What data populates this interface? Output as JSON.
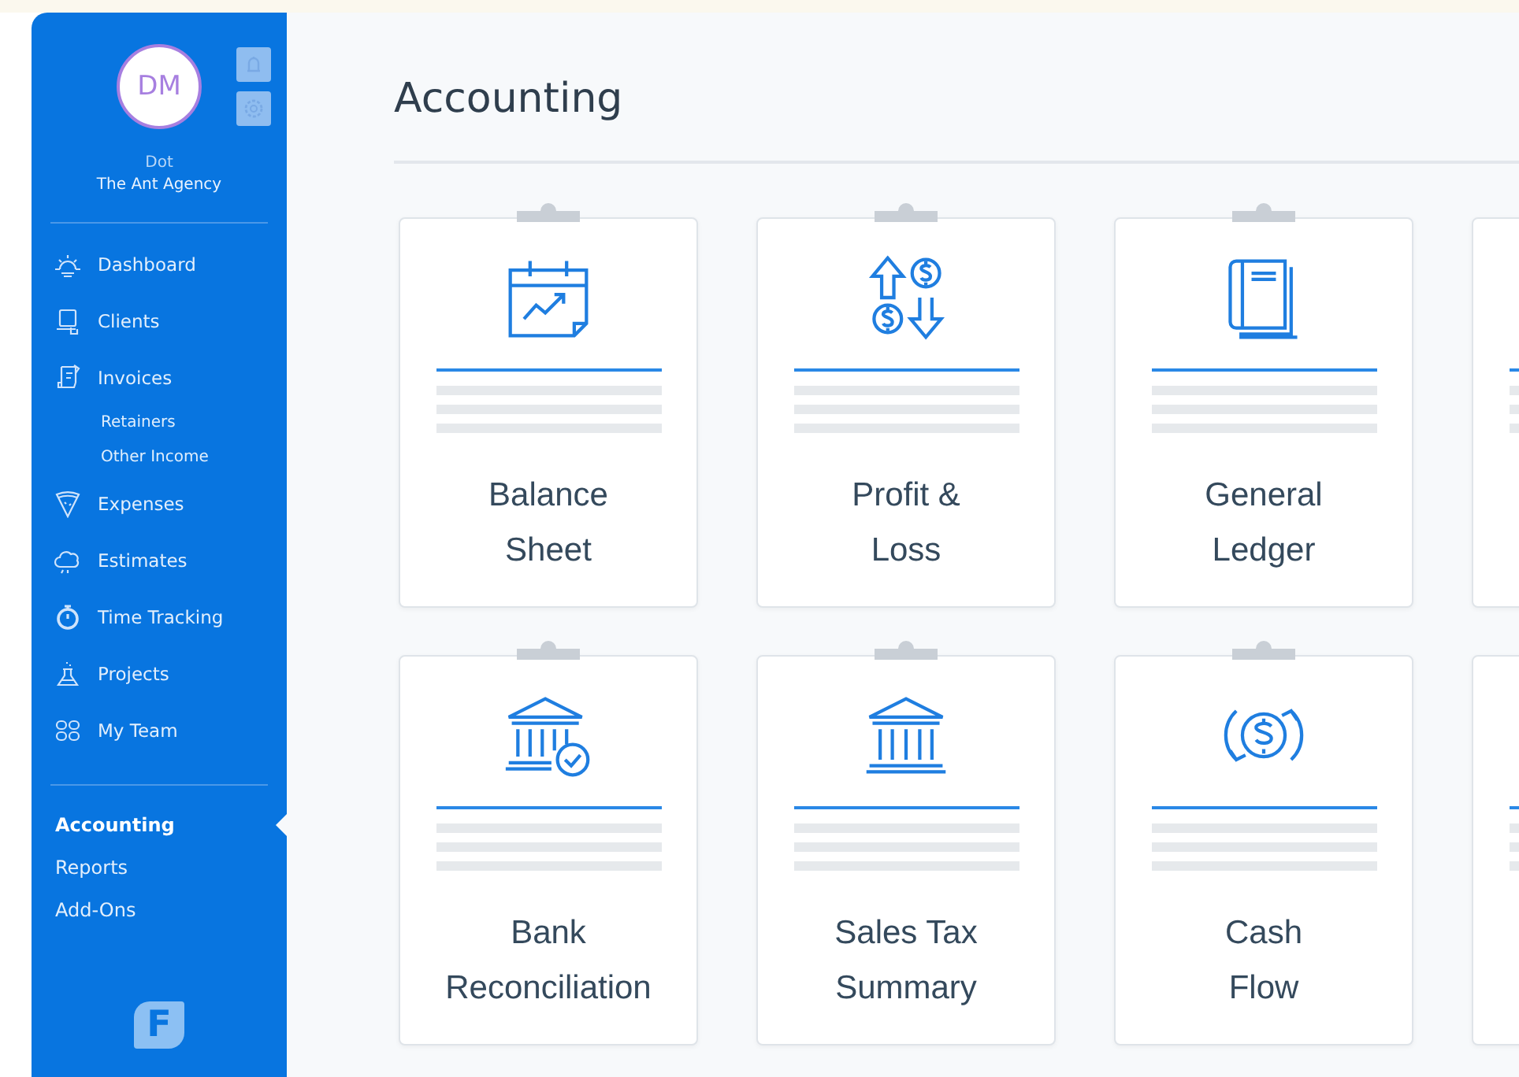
{
  "sidebar": {
    "avatar_initials": "DM",
    "user_name": "Dot",
    "company": "The Ant Agency",
    "nav": [
      {
        "label": "Dashboard",
        "selected": false
      },
      {
        "label": "Clients",
        "selected": false
      },
      {
        "label": "Invoices",
        "selected": false,
        "children": [
          {
            "label": "Retainers",
            "selected": false
          },
          {
            "label": "Other Income",
            "selected": false
          }
        ]
      },
      {
        "label": "Expenses",
        "selected": false
      },
      {
        "label": "Estimates",
        "selected": false
      },
      {
        "label": "Time Tracking",
        "selected": false
      },
      {
        "label": "Projects",
        "selected": false
      },
      {
        "label": "My Team",
        "selected": false
      }
    ],
    "secondary_nav": [
      {
        "label": "Accounting",
        "selected": true
      },
      {
        "label": "Reports",
        "selected": false
      },
      {
        "label": "Add-Ons",
        "selected": false
      }
    ],
    "logo": "F"
  },
  "page": {
    "title": "Accounting",
    "reports": [
      {
        "kind": "report",
        "title_lines": [
          "Balance",
          "Sheet"
        ]
      },
      {
        "kind": "report",
        "title_lines": [
          "Profit &",
          "Loss"
        ]
      },
      {
        "kind": "report",
        "title_lines": [
          "General",
          "Ledger"
        ]
      },
      {
        "kind": "cut"
      },
      {
        "kind": "report",
        "title_lines": [
          "Bank",
          "Reconciliation"
        ]
      },
      {
        "kind": "report",
        "title_lines": [
          "Sales Tax",
          "Summary"
        ]
      },
      {
        "kind": "report",
        "title_lines": [
          "Cash",
          "Flow"
        ]
      },
      {
        "kind": "cut"
      }
    ]
  }
}
